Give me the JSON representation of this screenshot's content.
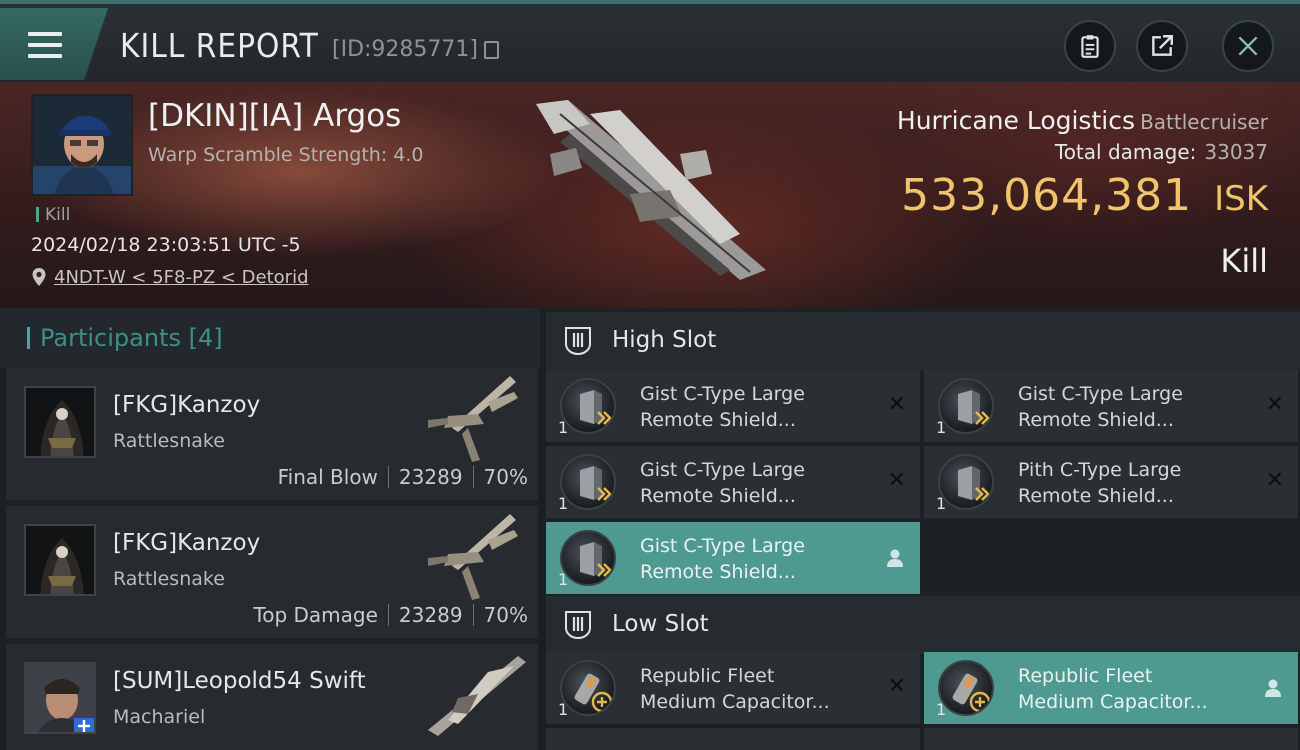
{
  "header": {
    "title": "KILL REPORT",
    "report_id": "[ID:9285771]"
  },
  "victim": {
    "name": "[DKIN][IA] Argos",
    "warp_scramble": "Warp Scramble Strength: 4.0",
    "kill_tag": "Kill",
    "datetime": "2024/02/18 23:03:51 UTC -5",
    "location": "4NDT-W < 5F8-PZ < Detorid",
    "ship_name": "Hurricane Logistics",
    "ship_class": "Battlecruiser",
    "total_damage_label": "Total damage:",
    "total_damage": "33037",
    "isk_value": "533,064,381",
    "isk_unit": "ISK",
    "result": "Kill"
  },
  "participants": {
    "title": "Participants",
    "count": "[4]",
    "rows": [
      {
        "name": "[FKG]Kanzoy",
        "ship": "Rattlesnake",
        "role": "Final Blow",
        "damage": "23289",
        "percent": "70%"
      },
      {
        "name": "[FKG]Kanzoy",
        "ship": "Rattlesnake",
        "role": "Top Damage",
        "damage": "23289",
        "percent": "70%"
      },
      {
        "name": "[SUM]Leopold54 Swift",
        "ship": "Machariel"
      }
    ]
  },
  "fitting": {
    "high_slot": {
      "title": "High Slot",
      "modules": [
        {
          "qty": "1",
          "line1": "Gist C-Type Large",
          "line2": "Remote Shield..."
        },
        {
          "qty": "1",
          "line1": "Gist C-Type Large",
          "line2": "Remote Shield..."
        },
        {
          "qty": "1",
          "line1": "Gist C-Type Large",
          "line2": "Remote Shield..."
        },
        {
          "qty": "1",
          "line1": "Pith C-Type Large",
          "line2": "Remote Shield..."
        },
        {
          "qty": "1",
          "line1": "Gist C-Type Large",
          "line2": "Remote Shield..."
        }
      ]
    },
    "low_slot": {
      "title": "Low Slot",
      "modules": [
        {
          "qty": "1",
          "line1": "Republic Fleet",
          "line2": "Medium Capacitor..."
        },
        {
          "qty": "1",
          "line1": "Republic Fleet",
          "line2": "Medium Capacitor..."
        }
      ]
    }
  },
  "colors": {
    "accent": "#4f9a90",
    "isk": "#f0c46b",
    "banner": "#4a2624"
  },
  "icons": [
    "hamburger-icon",
    "clipboard-icon",
    "share-icon",
    "close-icon",
    "location-pin-icon",
    "high-slot-icon",
    "low-slot-icon",
    "remove-icon",
    "person-icon"
  ]
}
